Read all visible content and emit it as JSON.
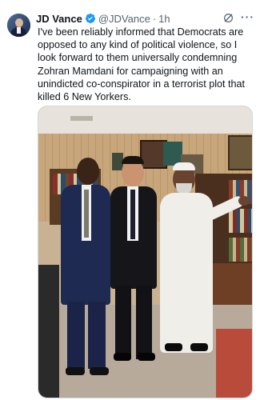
{
  "tweet": {
    "author_name": "JD Vance",
    "handle": "@JDVance",
    "separator": "·",
    "time": "1h",
    "body": "I've been reliably informed that Democrats are opposed to any kind of political violence, so I look forward to them universally condemning Zohran Mamdani for campaigning with an unindicted co-conspirator in a terrorist plot that killed 6 New Yorkers.",
    "verified_color": "#1d9bf0",
    "icons": {
      "avatar": "profile-avatar",
      "verified": "verified-badge-icon",
      "grok": "grok-icon",
      "more": "more-options-icon"
    }
  }
}
